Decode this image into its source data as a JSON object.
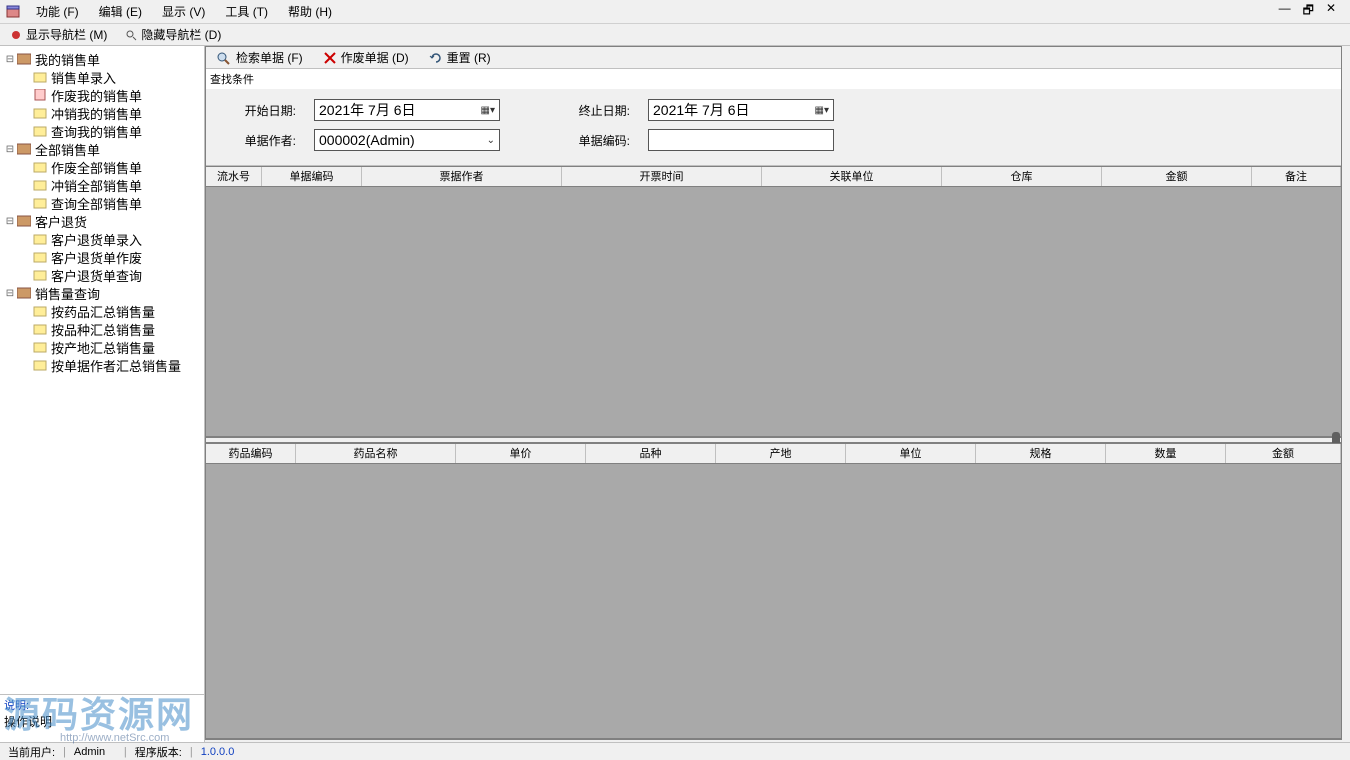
{
  "menu": {
    "function": "功能 (F)",
    "edit": "编辑 (E)",
    "view": "显示 (V)",
    "tools": "工具 (T)",
    "help": "帮助 (H)"
  },
  "win": {
    "min": "—",
    "restore": "🗗",
    "close": "✕"
  },
  "navbar": {
    "show_nav": "显示导航栏 (M)",
    "hide_nav": "隐藏导航栏 (D)"
  },
  "tree": {
    "g0": "我的销售单",
    "g0_0": "销售单录入",
    "g0_1": "作废我的销售单",
    "g0_2": "冲销我的销售单",
    "g0_3": "查询我的销售单",
    "g1": "全部销售单",
    "g1_0": "作废全部销售单",
    "g1_1": "冲销全部销售单",
    "g1_2": "查询全部销售单",
    "g2": "客户退货",
    "g2_0": "客户退货单录入",
    "g2_1": "客户退货单作废",
    "g2_2": "客户退货单查询",
    "g3": "销售量查询",
    "g3_0": "按药品汇总销售量",
    "g3_1": "按品种汇总销售量",
    "g3_2": "按产地汇总销售量",
    "g3_3": "按单据作者汇总销售量"
  },
  "explain": {
    "title": "说明:",
    "body": "操作说明"
  },
  "toolbar": {
    "search": "检索单据 (F)",
    "void": "作废单据 (D)",
    "reset": "重置 (R)"
  },
  "filters": {
    "section": "查找条件",
    "start_label": "开始日期:",
    "start_value": "2021年 7月 6日",
    "end_label": "终止日期:",
    "end_value": "2021年 7月 6日",
    "author_label": "单据作者:",
    "author_value": "000002(Admin)",
    "code_label": "单据编码:",
    "code_value": ""
  },
  "grid1": {
    "c0": "流水号",
    "c1": "单据编码",
    "c2": "票据作者",
    "c3": "开票时间",
    "c4": "关联单位",
    "c5": "仓库",
    "c6": "金额",
    "c7": "备注"
  },
  "grid2": {
    "c0": "药品编码",
    "c1": "药品名称",
    "c2": "单价",
    "c3": "品种",
    "c4": "产地",
    "c5": "单位",
    "c6": "规格",
    "c7": "数量",
    "c8": "金额"
  },
  "status": {
    "user_label": "当前用户:",
    "user": "Admin",
    "ver_label": "程序版本:",
    "ver": "1.0.0.0"
  },
  "watermark": {
    "big": "源码资源网",
    "small": "http://www.netSrc.com"
  }
}
